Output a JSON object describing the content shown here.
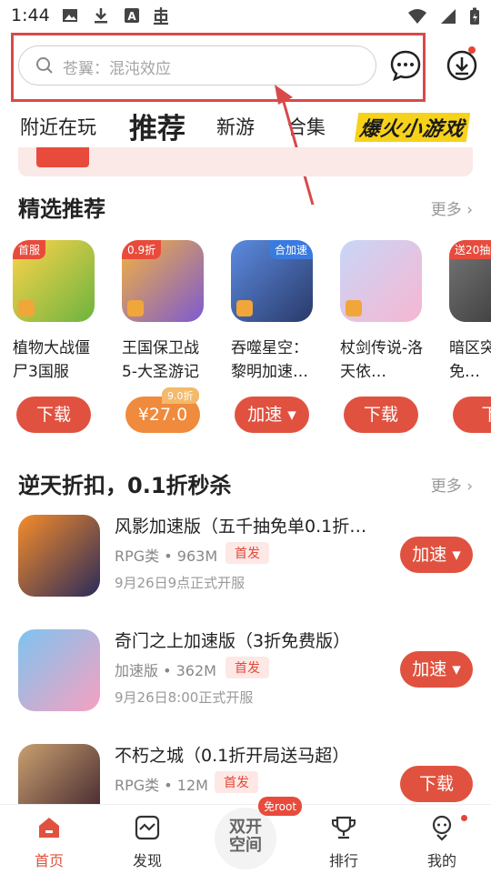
{
  "status": {
    "time": "1:44",
    "icons": [
      "image-icon",
      "download-icon",
      "a-icon",
      "bug-icon"
    ],
    "right_icons": [
      "wifi-icon",
      "signal-icon",
      "battery-icon"
    ]
  },
  "search": {
    "placeholder": "苍翼：混沌效应"
  },
  "tabs": [
    {
      "label": "附近在玩"
    },
    {
      "label": "推荐"
    },
    {
      "label": "新游"
    },
    {
      "label": "合集"
    },
    {
      "label": "爆火小游戏"
    }
  ],
  "section1": {
    "title": "精选推荐",
    "more": "更多"
  },
  "cards": [
    {
      "name": "植物大战僵尸3国服",
      "corner": "首服",
      "button": "下载",
      "colors": [
        "#6cb43f",
        "#ffd34a"
      ]
    },
    {
      "name": "王国保卫战5-大圣游记",
      "corner": "0.9折",
      "button": "¥27.0",
      "discount": "9.0折",
      "colors": [
        "#7d5ad1",
        "#f3b23d"
      ]
    },
    {
      "name": "吞噬星空：黎明加速…",
      "corner": "合加速",
      "button": "加速",
      "colors": [
        "#2a3a6a",
        "#5c8be0"
      ]
    },
    {
      "name": "杖剑传说-洛天依…",
      "corner": "",
      "button": "下载",
      "colors": [
        "#f7b6d2",
        "#c8d6f7"
      ]
    },
    {
      "name": "暗区突围-免…",
      "corner": "送20抽",
      "button": "下",
      "colors": [
        "#333",
        "#777"
      ]
    }
  ],
  "section2": {
    "title": "逆天折扣，0.1折秒杀",
    "more": "更多"
  },
  "rows": [
    {
      "title": "风影加速版（五千抽免单0.1折…",
      "category": "RPG类",
      "size": "963M",
      "tag": "首发",
      "date": "9月26日9点正式开服",
      "button": "加速",
      "colors": [
        "#f58c2a",
        "#2b2b5a"
      ]
    },
    {
      "title": "奇门之上加速版（3折免费版）",
      "category": "加速版",
      "size": "362M",
      "tag": "首发",
      "date": "9月26日8:00正式开服",
      "button": "加速",
      "colors": [
        "#f7a0c0",
        "#7ec4f0"
      ]
    },
    {
      "title": "不朽之城（0.1折开局送马超）",
      "category": "RPG类",
      "size": "12M",
      "tag": "首发",
      "date": "",
      "button": "下载",
      "colors": [
        "#3a1e2a",
        "#c9a070"
      ]
    }
  ],
  "bottom": {
    "items": [
      {
        "label": "首页"
      },
      {
        "label": "发现"
      },
      {
        "label": "排行"
      },
      {
        "label": "我的"
      }
    ],
    "center_line1": "双开",
    "center_line2": "空间",
    "root_badge": "免root"
  },
  "colors": {
    "accent": "#e0523f",
    "highlight_border": "#d84a4a"
  }
}
